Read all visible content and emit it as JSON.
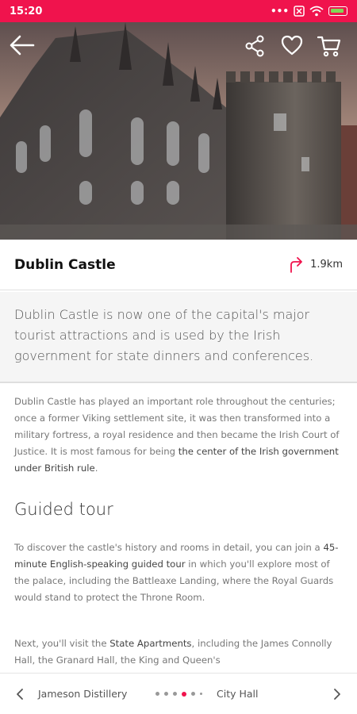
{
  "status_bar": {
    "time": "15:20"
  },
  "hero": {
    "image_alt": "Dublin Castle"
  },
  "place": {
    "title": "Dublin Castle",
    "distance": "1.9km"
  },
  "lead_text": "Dublin Castle is now one of the capital's major tourist attractions and is used by the Irish government for state dinners and conferences.",
  "paragraph1": {
    "text": "Dublin Castle has played an important role throughout the centuries; once a former Viking settlement site, it was then transformed into a military fortress, a royal residence and then became the Irish Court of Justice. It is most famous for being ",
    "bold": "the center of the Irish government under British rule",
    "end": "."
  },
  "section_heading": "Guided tour",
  "paragraph2": {
    "start": "To discover the castle's history and rooms in detail, you can join a ",
    "bold": "45-minute English-speaking guided tour",
    "end": " in which you'll explore most of the palace, including the Battleaxe Landing, where the Royal Guards would stand to protect the Throne Room."
  },
  "paragraph3": {
    "start": "Next, you'll visit the ",
    "bold": "State Apartments",
    "end": ", including the James Connolly Hall, the Granard Hall, the King and Queen's"
  },
  "bottom_nav": {
    "prev_label": "Jameson Distillery",
    "next_label": "City Hall",
    "dots_total": 6,
    "active_dot": 4
  },
  "colors": {
    "accent": "#f0134d"
  }
}
